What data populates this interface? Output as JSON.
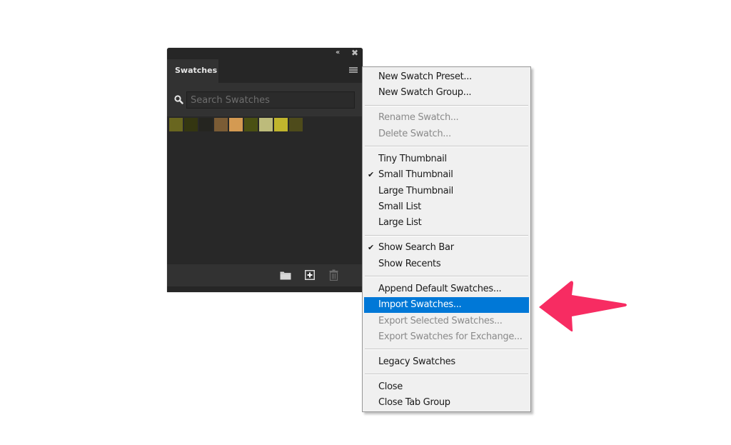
{
  "panel": {
    "tab_label": "Swatches",
    "collapse_glyph": "‹‹",
    "close_glyph": "✖",
    "search_placeholder": "Search Swatches",
    "search_value": "",
    "swatches": [
      {
        "name": "olive",
        "color": "#69661f"
      },
      {
        "name": "dark-olive",
        "color": "#343611"
      },
      {
        "name": "near-black",
        "color": "#252520"
      },
      {
        "name": "brown",
        "color": "#7b5c35"
      },
      {
        "name": "tan-orange",
        "color": "#d49a52"
      },
      {
        "name": "moss-green",
        "color": "#4a5012"
      },
      {
        "name": "pale-khaki",
        "color": "#bdbb7b"
      },
      {
        "name": "mustard-yellow",
        "color": "#c1b52d"
      },
      {
        "name": "dark-khaki",
        "color": "#4e4b1b"
      }
    ],
    "footer_icons": [
      "folder-icon",
      "new-swatch-icon",
      "trash-icon"
    ]
  },
  "menu": {
    "items": [
      {
        "label": "New Swatch Preset...",
        "enabled": true,
        "checked": false,
        "highlighted": false
      },
      {
        "label": "New Swatch Group...",
        "enabled": true,
        "checked": false,
        "highlighted": false
      },
      {
        "label": "Rename Swatch...",
        "enabled": false,
        "checked": false,
        "highlighted": false
      },
      {
        "label": "Delete Swatch...",
        "enabled": false,
        "checked": false,
        "highlighted": false
      },
      {
        "label": "Tiny Thumbnail",
        "enabled": true,
        "checked": false,
        "highlighted": false
      },
      {
        "label": "Small Thumbnail",
        "enabled": true,
        "checked": true,
        "highlighted": false
      },
      {
        "label": "Large Thumbnail",
        "enabled": true,
        "checked": false,
        "highlighted": false
      },
      {
        "label": "Small List",
        "enabled": true,
        "checked": false,
        "highlighted": false
      },
      {
        "label": "Large List",
        "enabled": true,
        "checked": false,
        "highlighted": false
      },
      {
        "label": "Show Search Bar",
        "enabled": true,
        "checked": true,
        "highlighted": false
      },
      {
        "label": "Show Recents",
        "enabled": true,
        "checked": false,
        "highlighted": false
      },
      {
        "label": "Append Default Swatches...",
        "enabled": true,
        "checked": false,
        "highlighted": false
      },
      {
        "label": "Import Swatches...",
        "enabled": true,
        "checked": false,
        "highlighted": true
      },
      {
        "label": "Export Selected Swatches...",
        "enabled": false,
        "checked": false,
        "highlighted": false
      },
      {
        "label": "Export Swatches for Exchange...",
        "enabled": false,
        "checked": false,
        "highlighted": false
      },
      {
        "label": "Legacy Swatches",
        "enabled": true,
        "checked": false,
        "highlighted": false
      },
      {
        "label": "Close",
        "enabled": true,
        "checked": false,
        "highlighted": false
      },
      {
        "label": "Close Tab Group",
        "enabled": true,
        "checked": false,
        "highlighted": false
      }
    ],
    "check_glyph": "✔"
  },
  "annotation": {
    "arrow_color": "#f72c62",
    "points_to": "Import Swatches..."
  }
}
